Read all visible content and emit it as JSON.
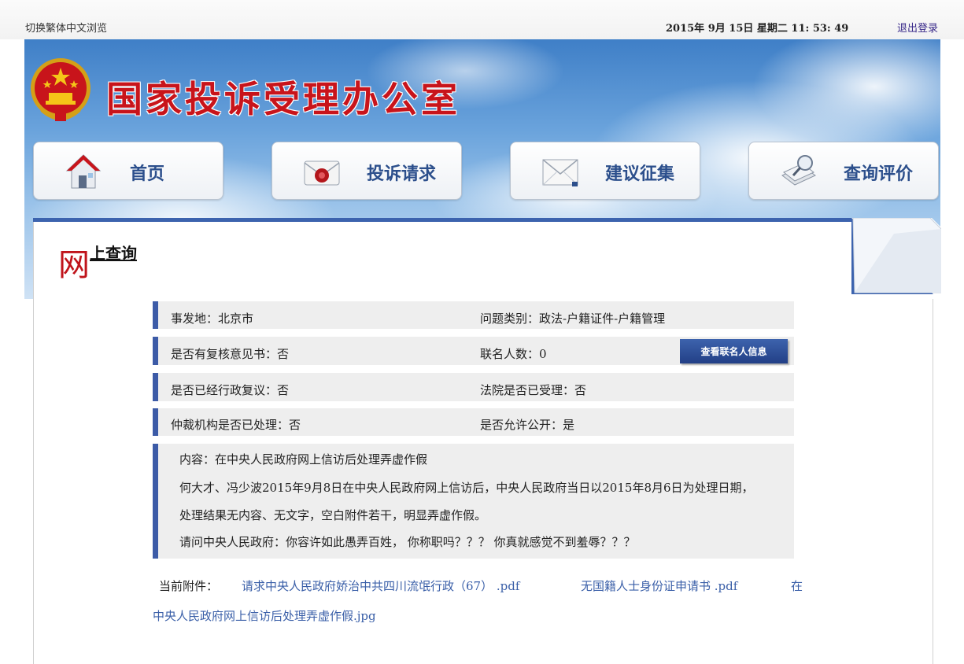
{
  "topbar": {
    "switch_label": "切换繁体中文浏览",
    "datetime": "2015年 9月 15日 星期二 11: 53: 49",
    "logout": "退出登录"
  },
  "banner": {
    "title": "国家投诉受理办公室",
    "nav": [
      {
        "label": "首页",
        "icon": "house-icon"
      },
      {
        "label": "投诉请求",
        "icon": "envelope-seal-icon"
      },
      {
        "label": "建议征集",
        "icon": "mail-letter-icon"
      },
      {
        "label": "查询评价",
        "icon": "search-document-icon"
      }
    ]
  },
  "section": {
    "title_big": "网",
    "title_rest": "上查询"
  },
  "details": [
    {
      "left": "事发地：北京市",
      "right": "问题类别：政法-户籍证件-户籍管理"
    },
    {
      "left": "是否有复核意见书：否",
      "right": "联名人数：0"
    },
    {
      "left": "是否已经行政复议：否",
      "right": "法院是否已受理：否"
    },
    {
      "left": "仲裁机构是否已处理：否",
      "right": "是否允许公开：是"
    }
  ],
  "view_signers_button": "查看联名人信息",
  "content": {
    "lines": [
      "内容：在中央人民政府网上信访后处理弄虚作假",
      "何大才、冯少波2015年9月8日在中央人民政府网上信访后，中央人民政府当日以2015年8月6日为处理日期，",
      "处理结果无内容、无文字，空白附件若干，明显弄虚作假。",
      "请问中央人民政府：你容许如此愚弄百姓， 你称职吗？？？ 你真就感觉不到羞辱？？？"
    ]
  },
  "attachments": {
    "label": "当前附件：",
    "files": [
      "请求中央人民政府娇治中共四川流氓行政（67） .pdf",
      "无国籍人士身份证申请书 .pdf",
      "在",
      "中央人民政府网上信访后处理弄虚作假.jpg"
    ]
  },
  "colors": {
    "accent_blue": "#3c5ba7",
    "title_red": "#c8141b",
    "link_blue": "#3a5fa8"
  }
}
